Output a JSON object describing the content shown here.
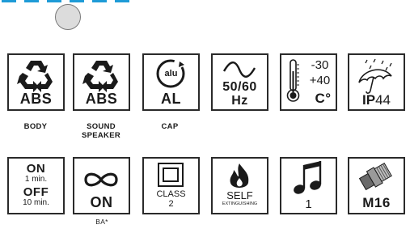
{
  "colors": {
    "accent": "#1e9bd7",
    "tile_border": "#2a2a2a",
    "toggle": "#dcdcdc"
  },
  "toggle": {
    "state": "off"
  },
  "row1": [
    {
      "icon": "recycle-icon",
      "main": "ABS",
      "caption": "BODY"
    },
    {
      "icon": "recycle-icon",
      "main": "ABS",
      "caption": "SOUND SPEAKER"
    },
    {
      "icon": "aluminium-recycle-icon",
      "icon_text": "alu",
      "main": "AL",
      "caption": "CAP"
    },
    {
      "icon": "sine-wave-icon",
      "main": "50/60",
      "sub": "Hz"
    },
    {
      "icon": "thermometer-icon",
      "min": "-30",
      "max": "+40",
      "unit": "C°"
    },
    {
      "icon": "umbrella-rain-icon",
      "main": "IP",
      "sub": "44"
    }
  ],
  "row2": [
    {
      "on": "ON",
      "on_time": "1 min.",
      "off": "OFF",
      "off_time": "10 min."
    },
    {
      "icon": "infinity-icon",
      "main": "ON",
      "caption": "BA*"
    },
    {
      "icon": "double-insulation-icon",
      "line1": "CLASS",
      "line2": "2"
    },
    {
      "icon": "flame-icon",
      "main": "SELF",
      "sub": "EXTINGUISHING"
    },
    {
      "icon": "music-note-icon",
      "main": "1"
    },
    {
      "icon": "cable-gland-icon",
      "main": "M16"
    }
  ]
}
